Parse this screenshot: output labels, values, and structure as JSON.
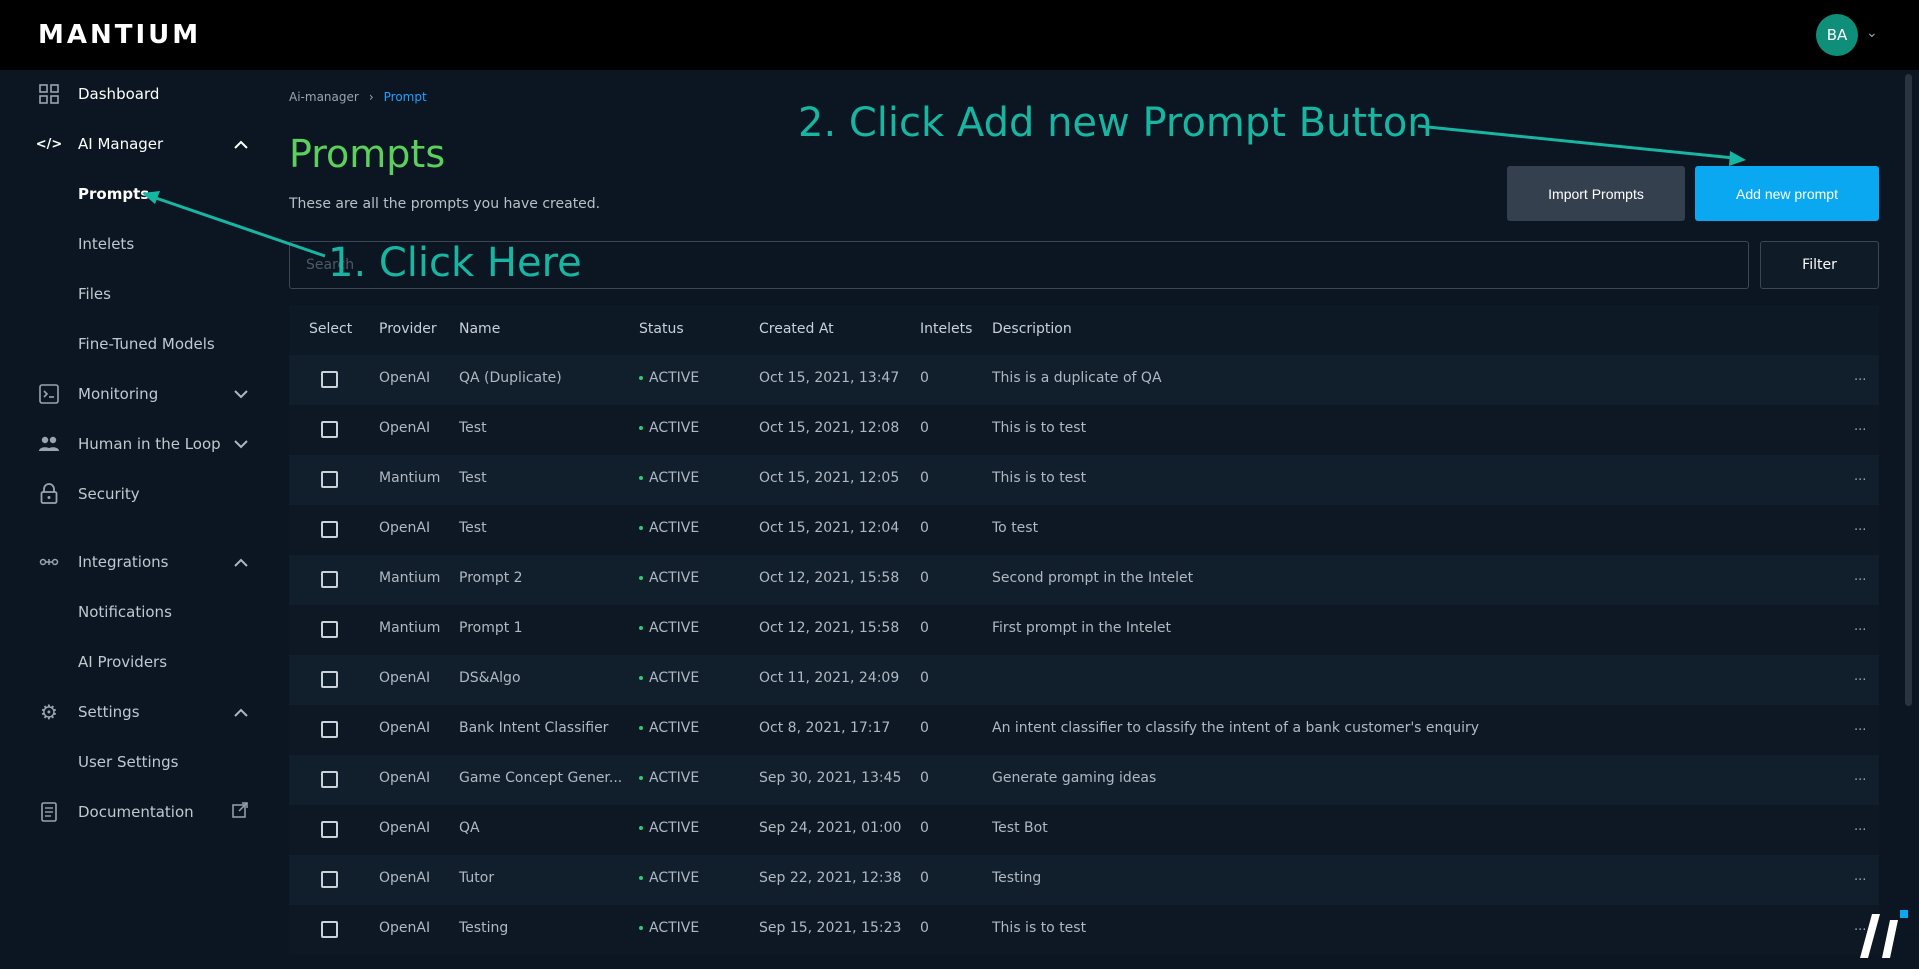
{
  "app": {
    "logo_text": "MANTIUM",
    "avatar_initials": "BA"
  },
  "sidebar": {
    "items": [
      {
        "label": "Dashboard",
        "icon": "dashboard-icon"
      },
      {
        "label": "AI Manager",
        "icon": "code-icon"
      },
      {
        "label": "Prompts"
      },
      {
        "label": "Intelets"
      },
      {
        "label": "Files"
      },
      {
        "label": "Fine-Tuned Models"
      },
      {
        "label": "Monitoring",
        "icon": "terminal-icon"
      },
      {
        "label": "Human in the Loop",
        "icon": "people-icon"
      },
      {
        "label": "Security",
        "icon": "lock-icon"
      },
      {
        "label": "Integrations",
        "icon": "integrations-icon"
      },
      {
        "label": "Notifications"
      },
      {
        "label": "AI Providers"
      },
      {
        "label": "Settings",
        "icon": "gear-icon"
      },
      {
        "label": "User Settings"
      },
      {
        "label": "Documentation",
        "icon": "document-icon"
      }
    ]
  },
  "breadcrumb": {
    "root": "Ai-manager",
    "separator": "›",
    "current": "Prompt"
  },
  "page": {
    "title": "Prompts",
    "subtitle": "These are all the prompts you have created."
  },
  "toolbar": {
    "import_label": "Import Prompts",
    "add_label": "Add new prompt",
    "filter_label": "Filter",
    "search_placeholder": "Search"
  },
  "table": {
    "columns": [
      "Select",
      "Provider",
      "Name",
      "Status",
      "Created At",
      "Intelets",
      "Description"
    ],
    "rows": [
      {
        "provider": "OpenAI",
        "name": "QA (Duplicate)",
        "status": "ACTIVE",
        "created": "Oct 15, 2021, 13:47",
        "intelets": "0",
        "description": "This is a duplicate of QA"
      },
      {
        "provider": "OpenAI",
        "name": "Test",
        "status": "ACTIVE",
        "created": "Oct 15, 2021, 12:08",
        "intelets": "0",
        "description": "This is to test"
      },
      {
        "provider": "Mantium",
        "name": "Test",
        "status": "ACTIVE",
        "created": "Oct 15, 2021, 12:05",
        "intelets": "0",
        "description": "This is to test"
      },
      {
        "provider": "OpenAI",
        "name": "Test",
        "status": "ACTIVE",
        "created": "Oct 15, 2021, 12:04",
        "intelets": "0",
        "description": "To test"
      },
      {
        "provider": "Mantium",
        "name": "Prompt 2",
        "status": "ACTIVE",
        "created": "Oct 12, 2021, 15:58",
        "intelets": "0",
        "description": "Second prompt in the Intelet"
      },
      {
        "provider": "Mantium",
        "name": "Prompt 1",
        "status": "ACTIVE",
        "created": "Oct 12, 2021, 15:58",
        "intelets": "0",
        "description": "First prompt in the Intelet"
      },
      {
        "provider": "OpenAI",
        "name": "DS&Algo",
        "status": "ACTIVE",
        "created": "Oct 11, 2021, 24:09",
        "intelets": "0",
        "description": ""
      },
      {
        "provider": "OpenAI",
        "name": "Bank Intent Classifier",
        "status": "ACTIVE",
        "created": "Oct 8, 2021, 17:17",
        "intelets": "0",
        "description": "An intent classifier to classify the intent of a bank customer's enquiry"
      },
      {
        "provider": "OpenAI",
        "name": "Game Concept Gener...",
        "status": "ACTIVE",
        "created": "Sep 30, 2021, 13:45",
        "intelets": "0",
        "description": "Generate gaming ideas"
      },
      {
        "provider": "OpenAI",
        "name": "QA",
        "status": "ACTIVE",
        "created": "Sep 24, 2021, 01:00",
        "intelets": "0",
        "description": "Test Bot"
      },
      {
        "provider": "OpenAI",
        "name": "Tutor",
        "status": "ACTIVE",
        "created": "Sep 22, 2021, 12:38",
        "intelets": "0",
        "description": "Testing"
      },
      {
        "provider": "OpenAI",
        "name": "Testing",
        "status": "ACTIVE",
        "created": "Sep 15, 2021, 15:23",
        "intelets": "0",
        "description": "This is to test"
      }
    ],
    "row_menu": "..."
  },
  "annotations": {
    "step1": "1. Click Here",
    "step2": "2. Click Add new Prompt Button",
    "color": "#17b6a3"
  },
  "colors": {
    "accent": "#0aa8f0",
    "title": "#5cd05c",
    "status_active": "#2ecc71",
    "avatar": "#0f8f7a"
  }
}
